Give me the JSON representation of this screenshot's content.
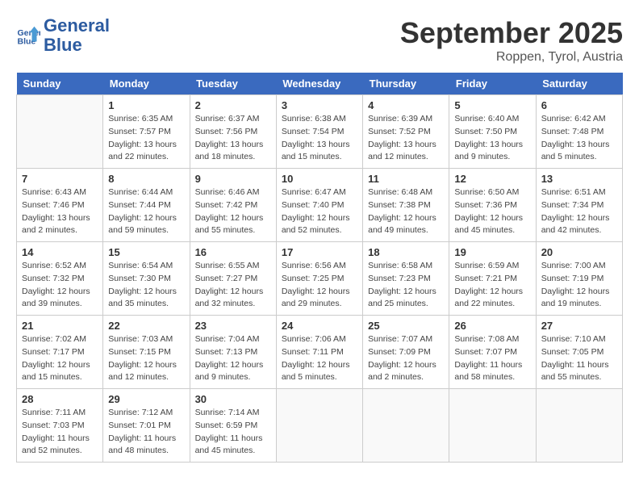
{
  "header": {
    "logo_line1": "General",
    "logo_line2": "Blue",
    "month": "September 2025",
    "location": "Roppen, Tyrol, Austria"
  },
  "weekdays": [
    "Sunday",
    "Monday",
    "Tuesday",
    "Wednesday",
    "Thursday",
    "Friday",
    "Saturday"
  ],
  "weeks": [
    [
      {
        "day": "",
        "info": ""
      },
      {
        "day": "1",
        "info": "Sunrise: 6:35 AM\nSunset: 7:57 PM\nDaylight: 13 hours\nand 22 minutes."
      },
      {
        "day": "2",
        "info": "Sunrise: 6:37 AM\nSunset: 7:56 PM\nDaylight: 13 hours\nand 18 minutes."
      },
      {
        "day": "3",
        "info": "Sunrise: 6:38 AM\nSunset: 7:54 PM\nDaylight: 13 hours\nand 15 minutes."
      },
      {
        "day": "4",
        "info": "Sunrise: 6:39 AM\nSunset: 7:52 PM\nDaylight: 13 hours\nand 12 minutes."
      },
      {
        "day": "5",
        "info": "Sunrise: 6:40 AM\nSunset: 7:50 PM\nDaylight: 13 hours\nand 9 minutes."
      },
      {
        "day": "6",
        "info": "Sunrise: 6:42 AM\nSunset: 7:48 PM\nDaylight: 13 hours\nand 5 minutes."
      }
    ],
    [
      {
        "day": "7",
        "info": "Sunrise: 6:43 AM\nSunset: 7:46 PM\nDaylight: 13 hours\nand 2 minutes."
      },
      {
        "day": "8",
        "info": "Sunrise: 6:44 AM\nSunset: 7:44 PM\nDaylight: 12 hours\nand 59 minutes."
      },
      {
        "day": "9",
        "info": "Sunrise: 6:46 AM\nSunset: 7:42 PM\nDaylight: 12 hours\nand 55 minutes."
      },
      {
        "day": "10",
        "info": "Sunrise: 6:47 AM\nSunset: 7:40 PM\nDaylight: 12 hours\nand 52 minutes."
      },
      {
        "day": "11",
        "info": "Sunrise: 6:48 AM\nSunset: 7:38 PM\nDaylight: 12 hours\nand 49 minutes."
      },
      {
        "day": "12",
        "info": "Sunrise: 6:50 AM\nSunset: 7:36 PM\nDaylight: 12 hours\nand 45 minutes."
      },
      {
        "day": "13",
        "info": "Sunrise: 6:51 AM\nSunset: 7:34 PM\nDaylight: 12 hours\nand 42 minutes."
      }
    ],
    [
      {
        "day": "14",
        "info": "Sunrise: 6:52 AM\nSunset: 7:32 PM\nDaylight: 12 hours\nand 39 minutes."
      },
      {
        "day": "15",
        "info": "Sunrise: 6:54 AM\nSunset: 7:30 PM\nDaylight: 12 hours\nand 35 minutes."
      },
      {
        "day": "16",
        "info": "Sunrise: 6:55 AM\nSunset: 7:27 PM\nDaylight: 12 hours\nand 32 minutes."
      },
      {
        "day": "17",
        "info": "Sunrise: 6:56 AM\nSunset: 7:25 PM\nDaylight: 12 hours\nand 29 minutes."
      },
      {
        "day": "18",
        "info": "Sunrise: 6:58 AM\nSunset: 7:23 PM\nDaylight: 12 hours\nand 25 minutes."
      },
      {
        "day": "19",
        "info": "Sunrise: 6:59 AM\nSunset: 7:21 PM\nDaylight: 12 hours\nand 22 minutes."
      },
      {
        "day": "20",
        "info": "Sunrise: 7:00 AM\nSunset: 7:19 PM\nDaylight: 12 hours\nand 19 minutes."
      }
    ],
    [
      {
        "day": "21",
        "info": "Sunrise: 7:02 AM\nSunset: 7:17 PM\nDaylight: 12 hours\nand 15 minutes."
      },
      {
        "day": "22",
        "info": "Sunrise: 7:03 AM\nSunset: 7:15 PM\nDaylight: 12 hours\nand 12 minutes."
      },
      {
        "day": "23",
        "info": "Sunrise: 7:04 AM\nSunset: 7:13 PM\nDaylight: 12 hours\nand 9 minutes."
      },
      {
        "day": "24",
        "info": "Sunrise: 7:06 AM\nSunset: 7:11 PM\nDaylight: 12 hours\nand 5 minutes."
      },
      {
        "day": "25",
        "info": "Sunrise: 7:07 AM\nSunset: 7:09 PM\nDaylight: 12 hours\nand 2 minutes."
      },
      {
        "day": "26",
        "info": "Sunrise: 7:08 AM\nSunset: 7:07 PM\nDaylight: 11 hours\nand 58 minutes."
      },
      {
        "day": "27",
        "info": "Sunrise: 7:10 AM\nSunset: 7:05 PM\nDaylight: 11 hours\nand 55 minutes."
      }
    ],
    [
      {
        "day": "28",
        "info": "Sunrise: 7:11 AM\nSunset: 7:03 PM\nDaylight: 11 hours\nand 52 minutes."
      },
      {
        "day": "29",
        "info": "Sunrise: 7:12 AM\nSunset: 7:01 PM\nDaylight: 11 hours\nand 48 minutes."
      },
      {
        "day": "30",
        "info": "Sunrise: 7:14 AM\nSunset: 6:59 PM\nDaylight: 11 hours\nand 45 minutes."
      },
      {
        "day": "",
        "info": ""
      },
      {
        "day": "",
        "info": ""
      },
      {
        "day": "",
        "info": ""
      },
      {
        "day": "",
        "info": ""
      }
    ]
  ]
}
